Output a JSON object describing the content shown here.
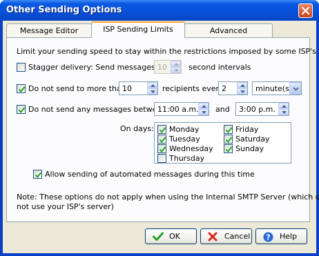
{
  "window": {
    "title": "Other Sending Options"
  },
  "tabs": [
    {
      "label": "Message Editor"
    },
    {
      "label": "ISP Sending Limits"
    },
    {
      "label": "Advanced"
    }
  ],
  "panel": {
    "intro": "Limit your sending speed to stay within the restrictions imposed by some ISP's",
    "stagger": {
      "label": "Stagger delivery: Send messages at",
      "checked": false,
      "value": "10",
      "suffix": "second intervals"
    },
    "limit": {
      "label": "Do not send to more than",
      "checked": true,
      "count": "10",
      "middle": "recipients every",
      "every": "2",
      "unit": "minute(s)"
    },
    "window_rule": {
      "label": "Do not send any messages between",
      "checked": true,
      "start": "11:00 a.m.",
      "and": "and",
      "end": "3:00 p.m."
    },
    "days_label": "On days:",
    "days": [
      {
        "label": "Monday",
        "checked": true
      },
      {
        "label": "Tuesday",
        "checked": true
      },
      {
        "label": "Wednesday",
        "checked": true
      },
      {
        "label": "Thursday",
        "checked": false
      },
      {
        "label": "Friday",
        "checked": true
      },
      {
        "label": "Saturday",
        "checked": true
      },
      {
        "label": "Sunday",
        "checked": true
      }
    ],
    "automated": {
      "label": "Allow sending of automated messages during this time",
      "checked": true
    },
    "note_line1": "Note: These options do not apply when using the Internal SMTP Server (which does",
    "note_line2": "not use your ISP's server)"
  },
  "buttons": {
    "ok": "OK",
    "cancel": "Cancel",
    "help": "Help"
  },
  "colors": {
    "accent": "#0b58e3",
    "check": "#21a121",
    "active_tab": "#f9a437"
  }
}
